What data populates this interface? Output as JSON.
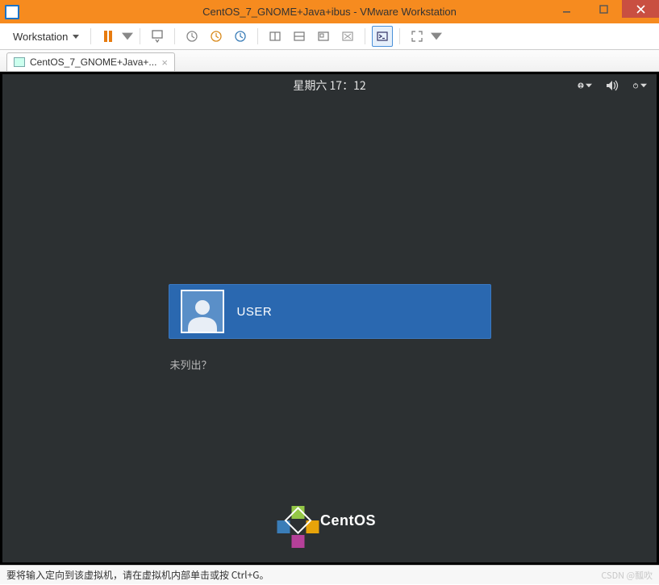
{
  "window": {
    "title": "CentOS_7_GNOME+Java+ibus - VMware Workstation"
  },
  "toolbar": {
    "menu_label": "Workstation"
  },
  "tab": {
    "label": "CentOS_7_GNOME+Java+..."
  },
  "gdm": {
    "clock": "星期六 17：12",
    "user": "USER",
    "not_listed": "未列出？",
    "brand": "CentOS"
  },
  "statusbar": {
    "hint": "要将输入定向到该虚拟机，请在虚拟机内部单击或按 Ctrl+G。",
    "watermark": "CSDN @瓢吹"
  }
}
